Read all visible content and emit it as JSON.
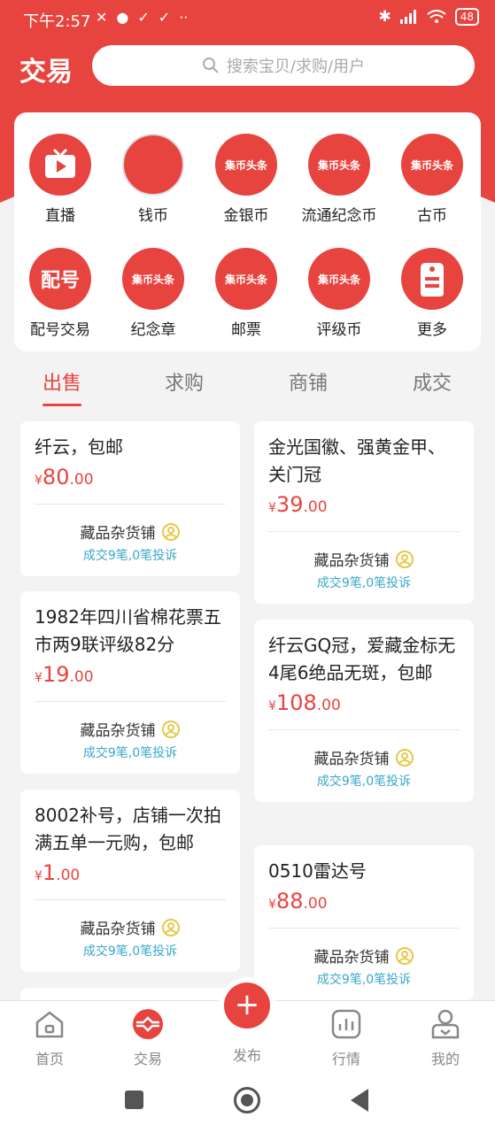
{
  "status_bar": {
    "time": "下午2:57",
    "battery": "48"
  },
  "header": {
    "title": "交易",
    "search_placeholder": "搜索宝贝/求购/用户"
  },
  "categories": [
    {
      "label": "直播",
      "icon": "tv-play-icon"
    },
    {
      "label": "钱币",
      "icon": "banknote-photo-icon"
    },
    {
      "label": "金银币",
      "icon": "qbtt-logo-icon",
      "logo_text": "集币头条"
    },
    {
      "label": "流通纪念币",
      "icon": "qbtt-logo-icon",
      "logo_text": "集币头条"
    },
    {
      "label": "古币",
      "icon": "qbtt-logo-icon",
      "logo_text": "集币头条"
    },
    {
      "label": "配号交易",
      "icon": "peihao-icon",
      "logo_text": "配号"
    },
    {
      "label": "纪念章",
      "icon": "qbtt-logo-icon",
      "logo_text": "集币头条"
    },
    {
      "label": "邮票",
      "icon": "qbtt-logo-icon",
      "logo_text": "集币头条"
    },
    {
      "label": "评级币",
      "icon": "qbtt-logo-icon",
      "logo_text": "集币头条"
    },
    {
      "label": "更多",
      "icon": "more-tag-icon"
    }
  ],
  "tabs": [
    "出售",
    "求购",
    "商铺",
    "成交"
  ],
  "active_tab": "出售",
  "products": [
    {
      "title": "纤云，包邮",
      "price_symbol": "¥",
      "price_int": "80",
      "price_dec": ".00",
      "shop": "藏品杂货铺",
      "stats": "成交9笔,0笔投诉"
    },
    {
      "title": "金光国徽、强黄金甲、关门冠",
      "price_symbol": "¥",
      "price_int": "39",
      "price_dec": ".00",
      "shop": "藏品杂货铺",
      "stats": "成交9笔,0笔投诉"
    },
    {
      "title": "1982年四川省棉花票五市两9联评级82分",
      "price_symbol": "¥",
      "price_int": "19",
      "price_dec": ".00",
      "shop": "藏品杂货铺",
      "stats": "成交9笔,0笔投诉"
    },
    {
      "title": "纤云GQ冠，爱藏金标无4尾6绝品无斑，包邮",
      "price_symbol": "¥",
      "price_int": "108",
      "price_dec": ".00",
      "shop": "藏品杂货铺",
      "stats": "成交9笔,0笔投诉"
    },
    {
      "title": "8002补号，店铺一次拍满五单一元购，包邮",
      "price_symbol": "¥",
      "price_int": "1",
      "price_dec": ".00",
      "shop": "藏品杂货铺",
      "stats": "成交9笔,0笔投诉"
    },
    {
      "title": "0510雷达号",
      "price_symbol": "¥",
      "price_int": "88",
      "price_dec": ".00",
      "shop": "藏品杂货铺",
      "stats": "成交9笔,0笔投诉"
    }
  ],
  "bottom_nav": [
    {
      "label": "首页",
      "icon": "home-icon"
    },
    {
      "label": "交易",
      "icon": "trade-icon"
    },
    {
      "label": "发布",
      "icon": "plus-icon"
    },
    {
      "label": "行情",
      "icon": "market-chart-icon"
    },
    {
      "label": "我的",
      "icon": "profile-icon"
    }
  ],
  "publish_symbol": "+",
  "colors": {
    "accent": "#e8443f",
    "stats": "#39a8c9",
    "medal": "#e6c84a"
  }
}
